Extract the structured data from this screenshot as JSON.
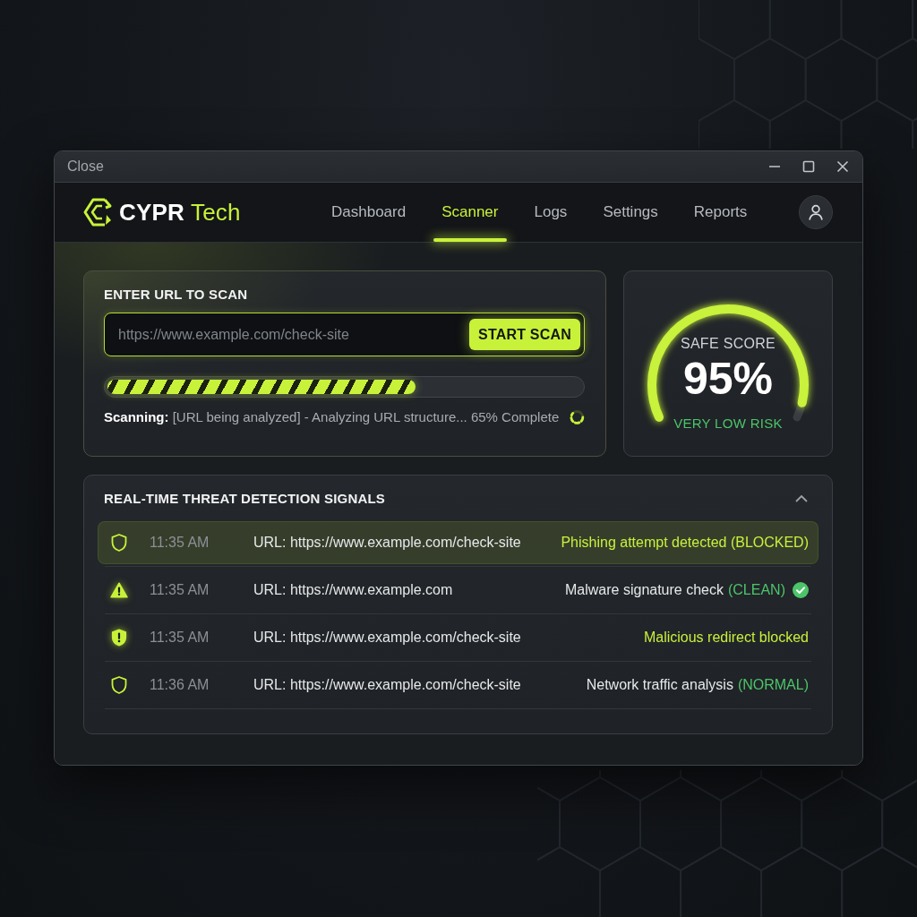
{
  "window": {
    "title": "Close"
  },
  "nav": {
    "brand": "**CYPR** Tech",
    "tabs": [
      {
        "label": "Dashboard",
        "selected": false
      },
      {
        "label": "Scanner",
        "selected": true
      },
      {
        "label": "Logs",
        "selected": false
      },
      {
        "label": "Settings",
        "selected": false
      },
      {
        "label": "Reports",
        "selected": false
      }
    ]
  },
  "scan": {
    "heading": "ENTER URL TO SCAN",
    "url_field": {
      "placeholder": "https://www.example.com/check-site"
    },
    "button": "START SCAN",
    "progress": {
      "level": 0.65
    },
    "status": "**Scanning:** [URL being analyzed] - Analyzing URL structure... 65% Complete"
  },
  "score": {
    "label": "SAFE SCORE",
    "value": "95%",
    "risk": "VERY LOW RISK"
  },
  "threats": {
    "title": "REAL-TIME THREAT DETECTION SIGNALS",
    "expanded": true,
    "rows": [
      {
        "kind": "blocked",
        "selected": true,
        "time": "11:35 AM",
        "url": "URL: https://www.example.com/check-site",
        "message": "Phishing attempt detected (BLOCKED)",
        "verified": false
      },
      {
        "kind": "warning",
        "selected": false,
        "time": "11:35 AM",
        "url": "URL: https://www.example.com",
        "message": "Malware signature check",
        "status": "(CLEAN)",
        "verified": true
      },
      {
        "kind": "alert",
        "selected": false,
        "time": "11:35 AM",
        "url": "URL: https://www.example.com/check-site",
        "message": "Malicious redirect blocked",
        "verified": false
      },
      {
        "kind": "normal",
        "selected": false,
        "time": "11:36 AM",
        "url": "URL: https://www.example.com/check-site",
        "message": "Network traffic analysis",
        "status": "(NORMAL)",
        "verified": false
      }
    ]
  }
}
